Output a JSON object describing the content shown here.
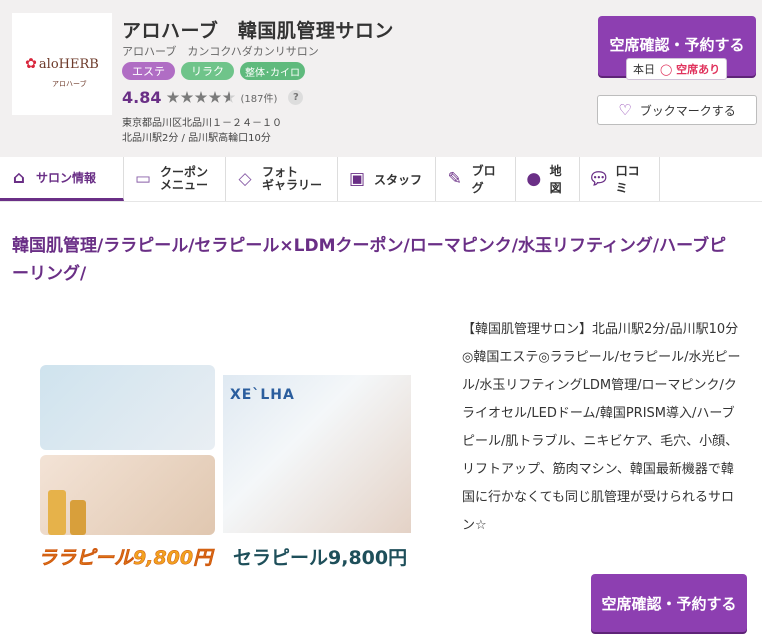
{
  "salon": {
    "logo_text": "aloHERB",
    "logo_sub": "アロハーブ",
    "name": "アロハーブ　韓国肌管理サロン",
    "kana": "アロハーブ　カンコクハダカンリサロン",
    "tags": [
      "エステ",
      "リラク",
      "整体･カイロ"
    ],
    "rating": "4.84",
    "rating_value": 4.84,
    "review_count": "(187件)",
    "help_icon": "?",
    "address_line1": "東京都品川区北品川１－２４－１０",
    "address_line2": "北品川駅2分 / 品川駅高輪口10分"
  },
  "actions": {
    "reserve_label": "空席確認・予約する",
    "avail_day": "本日",
    "avail_status": "◯ 空席あり",
    "bookmark_label": "ブックマークする",
    "reserve_label_bottom": "空席確認・予約する"
  },
  "tabs": [
    {
      "label": "サロン情報",
      "icon": "home-icon"
    },
    {
      "label": "クーポン\nメニュー",
      "line1": "クーポン",
      "line2": "メニュー",
      "icon": "ticket-icon"
    },
    {
      "label": "フォト\nギャラリー",
      "line1": "フォト",
      "line2": "ギャラリー",
      "icon": "photo-icon"
    },
    {
      "label": "スタッフ",
      "icon": "id-card-icon"
    },
    {
      "label": "ブログ",
      "icon": "pencil-icon"
    },
    {
      "label": "地図",
      "icon": "map-pin-icon"
    },
    {
      "label": "口コミ",
      "icon": "speech-bubble-icon"
    }
  ],
  "catch_copy": "韓国肌管理/ララピール/セラピール×LDMクーポン/ローマピンク/水玉リフティング/ハーブピーリング/",
  "promo": {
    "brand": "XE`LHA",
    "price_left": "ララピール9,800円",
    "price_right": "セラピール9,800円"
  },
  "description": "【韓国肌管理サロン】北品川駅2分/品川駅10分◎韓国エステ◎ララピール/セラピール/水光ピール/水玉リフティングLDM管理/ローマピンク/クライオセル/LEDドーム/韓国PRISM導入/ハーブピール/肌トラブル、ニキビケア、毛穴、小顔、リフトアップ、筋肉マシン、韓国最新機器で韓国に行かなくても同じ肌管理が受けられるサロン☆",
  "colors": {
    "accent": "#6a2f86",
    "button": "#8d3fb1",
    "available": "#e0335d"
  }
}
